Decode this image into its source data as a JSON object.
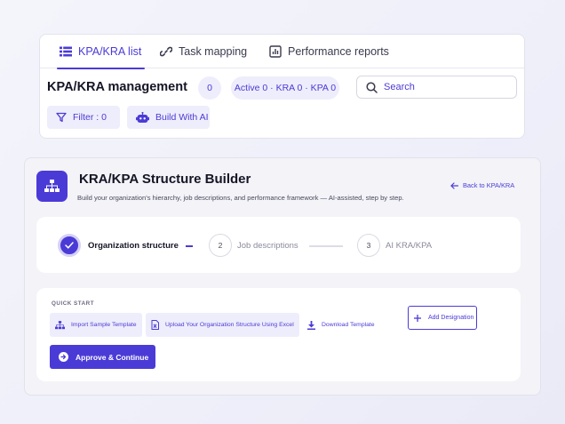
{
  "header": {
    "tabs": [
      {
        "label": "KPA/KRA list",
        "icon": "list-icon",
        "active": true
      },
      {
        "label": "Task mapping",
        "icon": "link-icon",
        "active": false
      },
      {
        "label": "Performance reports",
        "icon": "bar-chart-icon",
        "active": false
      }
    ],
    "title": "KPA/KRA management",
    "count_badge": "0",
    "active_summary": "Active 0 · KRA 0 · KPA 0",
    "search": {
      "placeholder": "Search",
      "value": ""
    },
    "filter_label": "Filter : 0",
    "build_ai_label": "Build With AI"
  },
  "builder": {
    "title": "KRA/KPA Structure Builder",
    "subtitle": "Build your organization's hierarchy, job descriptions, and performance framework — AI-assisted, step by step.",
    "back_label": "Back to KPA/KRA",
    "steps": [
      {
        "number": "",
        "label": "Organization structure",
        "status": "completed"
      },
      {
        "number": "2",
        "label": "Job descriptions",
        "status": "pending"
      },
      {
        "number": "3",
        "label": "AI KRA/KPA",
        "status": "pending"
      }
    ],
    "quick_start": {
      "label": "QUICK START",
      "import_label": "Import Sample Template",
      "upload_label": "Upload Your Organization Structure Using Excel",
      "download_label": "Download Template",
      "add_designation_label": "Add Designation",
      "approve_label": "Approve & Continue"
    }
  },
  "colors": {
    "accent": "#4b3bd6",
    "accent_soft": "#eeedfb",
    "background": "#f3f3f8"
  }
}
